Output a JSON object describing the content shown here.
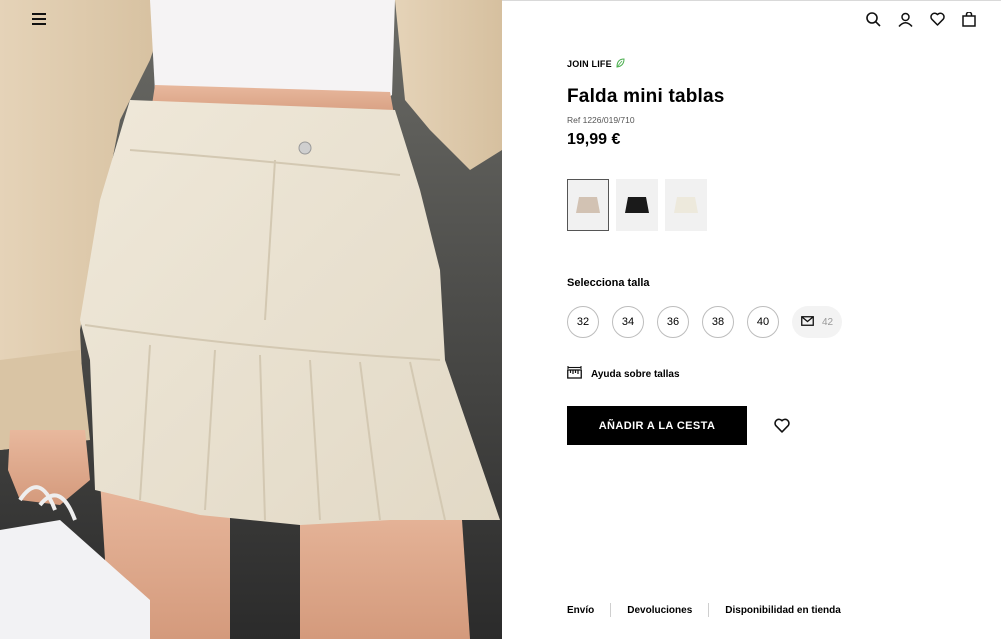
{
  "header": {
    "menu_icon": "hamburger-menu-icon",
    "icons": [
      "search-icon",
      "user-icon",
      "heart-icon",
      "shopping-bag-icon"
    ]
  },
  "product": {
    "badge": "JOIN LIFE",
    "badge_icon": "leaf-icon",
    "badge_color": "#4caf50",
    "title": "Falda mini tablas",
    "ref": "Ref 1226/019/710",
    "price": "19,99 €"
  },
  "colors": [
    {
      "name": "beige",
      "hex": "#d2c2b3",
      "selected": true
    },
    {
      "name": "black",
      "hex": "#1a1a1a",
      "selected": false
    },
    {
      "name": "cream",
      "hex": "#ede9dc",
      "selected": false
    }
  ],
  "size_section": {
    "label": "Selecciona talla",
    "sizes": [
      "32",
      "34",
      "36",
      "38",
      "40"
    ],
    "out_of_stock_size": "42",
    "out_of_stock_icon": "mail-icon"
  },
  "size_help": {
    "label": "Ayuda sobre tallas",
    "icon": "ruler-icon"
  },
  "actions": {
    "add_to_cart": "AÑADIR A LA CESTA",
    "wishlist_icon": "heart-icon"
  },
  "footer": {
    "links": [
      "Envío",
      "Devoluciones",
      "Disponibilidad en tienda"
    ]
  },
  "colors_theme": {
    "accent": "#000000",
    "border": "#bdbdbd"
  }
}
